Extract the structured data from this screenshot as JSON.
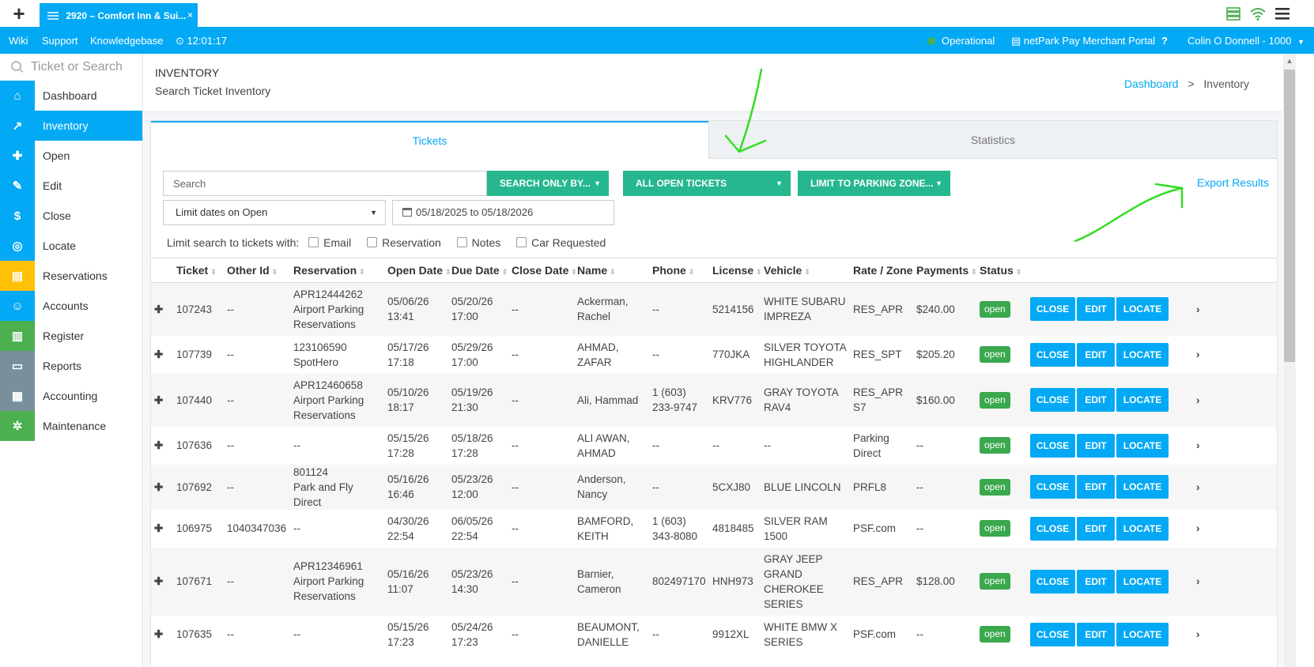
{
  "browser": {
    "new_tab": "+",
    "tab_title": "2920 – Comfort Inn & Sui...",
    "tab_close": "×"
  },
  "navbar": {
    "links": [
      "Wiki",
      "Support",
      "Knowledgebase"
    ],
    "clock": "12:01:17",
    "status": "Operational",
    "merchant_portal": "netPark Pay Merchant Portal",
    "help": "?",
    "user": "Colin O Donnell - 1000"
  },
  "sidebar": {
    "search_placeholder": "Ticket or Search",
    "items": [
      {
        "label": "Dashboard",
        "icon": "home-icon",
        "color": "#03a9f4"
      },
      {
        "label": "Inventory",
        "icon": "chart-icon",
        "color": "#03a9f4",
        "active": true
      },
      {
        "label": "Open",
        "icon": "plus-icon",
        "color": "#03a9f4"
      },
      {
        "label": "Edit",
        "icon": "pencil-icon",
        "color": "#03a9f4"
      },
      {
        "label": "Close",
        "icon": "dollar-icon",
        "color": "#03a9f4"
      },
      {
        "label": "Locate",
        "icon": "binoculars-icon",
        "color": "#03a9f4"
      },
      {
        "label": "Reservations",
        "icon": "document-icon",
        "color": "#ffc107"
      },
      {
        "label": "Accounts",
        "icon": "users-icon",
        "color": "#03a9f4"
      },
      {
        "label": "Register",
        "icon": "bank-icon",
        "color": "#4caf50"
      },
      {
        "label": "Reports",
        "icon": "folder-icon",
        "color": "#78909c"
      },
      {
        "label": "Accounting",
        "icon": "bar-chart-icon",
        "color": "#78909c"
      },
      {
        "label": "Maintenance",
        "icon": "gear-icon",
        "color": "#4caf50"
      }
    ]
  },
  "page": {
    "title": "INVENTORY",
    "subtitle": "Search Ticket Inventory",
    "breadcrumb_home": "Dashboard",
    "breadcrumb_sep": ">",
    "breadcrumb_current": "Inventory"
  },
  "tabs": {
    "tickets": "Tickets",
    "statistics": "Statistics"
  },
  "filters": {
    "search_placeholder": "Search",
    "search_only_by": "SEARCH ONLY BY...",
    "all_open_tickets": "ALL OPEN TICKETS",
    "limit_zone": "LIMIT TO PARKING ZONE...",
    "limit_dates": "Limit dates on Open",
    "date_range": "05/18/2025 to 05/18/2026",
    "export": "Export Results",
    "limit_label": "Limit search to tickets with:",
    "checkboxes": [
      "Email",
      "Reservation",
      "Notes",
      "Car Requested"
    ]
  },
  "table": {
    "columns": [
      "Ticket",
      "Other Id",
      "Reservation",
      "Open Date",
      "Due Date",
      "Close Date",
      "Name",
      "Phone",
      "License",
      "Vehicle",
      "Rate / Zone",
      "Payments",
      "Status"
    ],
    "actions": {
      "close": "CLOSE",
      "edit": "EDIT",
      "locate": "LOCATE"
    },
    "rows": [
      {
        "ticket": "107243",
        "other_id": "--",
        "reservation": [
          "APR12444262",
          "Airport Parking",
          "Reservations"
        ],
        "open": [
          "05/06/26",
          "13:41"
        ],
        "due": [
          "05/20/26",
          "17:00"
        ],
        "close": "--",
        "name": [
          "Ackerman,",
          "Rachel"
        ],
        "phone": [
          "--"
        ],
        "license": "5214156",
        "vehicle": [
          "WHITE SUBARU",
          "IMPREZA"
        ],
        "rate": [
          "RES_APR"
        ],
        "payments": "$240.00",
        "status": "open"
      },
      {
        "ticket": "107739",
        "other_id": "--",
        "reservation": [
          "123106590",
          "SpotHero"
        ],
        "open": [
          "05/17/26",
          "17:18"
        ],
        "due": [
          "05/29/26",
          "17:00"
        ],
        "close": "--",
        "name": [
          "AHMAD,",
          "ZAFAR"
        ],
        "phone": [
          "--"
        ],
        "license": "770JKA",
        "vehicle": [
          "SILVER TOYOTA",
          "HIGHLANDER"
        ],
        "rate": [
          "RES_SPT"
        ],
        "payments": "$205.20",
        "status": "open"
      },
      {
        "ticket": "107440",
        "other_id": "--",
        "reservation": [
          "APR12460658",
          "Airport Parking",
          "Reservations"
        ],
        "open": [
          "05/10/26",
          "18:17"
        ],
        "due": [
          "05/19/26",
          "21:30"
        ],
        "close": "--",
        "name": [
          "Ali, Hammad"
        ],
        "phone": [
          "1 (603)",
          "233-9747"
        ],
        "license": "KRV776",
        "vehicle": [
          "GRAY TOYOTA",
          "RAV4"
        ],
        "rate": [
          "RES_APR",
          "S7"
        ],
        "payments": "$160.00",
        "status": "open"
      },
      {
        "ticket": "107636",
        "other_id": "--",
        "reservation": [
          "--"
        ],
        "open": [
          "05/15/26",
          "17:28"
        ],
        "due": [
          "05/18/26",
          "17:28"
        ],
        "close": "--",
        "name": [
          "ALI AWAN,",
          "AHMAD"
        ],
        "phone": [
          "--"
        ],
        "license": "--",
        "vehicle": [
          "--"
        ],
        "rate": [
          "Parking",
          "Direct"
        ],
        "payments": "--",
        "status": "open"
      },
      {
        "ticket": "107692",
        "other_id": "--",
        "reservation": [
          "801124",
          "Park and Fly Direct"
        ],
        "open": [
          "05/16/26",
          "16:46"
        ],
        "due": [
          "05/23/26",
          "12:00"
        ],
        "close": "--",
        "name": [
          "Anderson,",
          "Nancy"
        ],
        "phone": [
          "--"
        ],
        "license": "5CXJ80",
        "vehicle": [
          "BLUE LINCOLN"
        ],
        "rate": [
          "PRFL8"
        ],
        "payments": "--",
        "status": "open"
      },
      {
        "ticket": "106975",
        "other_id": "1040347036",
        "reservation": [
          "--"
        ],
        "open": [
          "04/30/26",
          "22:54"
        ],
        "due": [
          "06/05/26",
          "22:54"
        ],
        "close": "--",
        "name": [
          "BAMFORD,",
          "KEITH"
        ],
        "phone": [
          "1 (603)",
          "343-8080"
        ],
        "license": "4818485",
        "vehicle": [
          "SILVER RAM",
          "1500"
        ],
        "rate": [
          "PSF.com"
        ],
        "payments": "--",
        "status": "open"
      },
      {
        "ticket": "107671",
        "other_id": "--",
        "reservation": [
          "APR12346961",
          "Airport Parking",
          "Reservations"
        ],
        "open": [
          "05/16/26",
          "11:07"
        ],
        "due": [
          "05/23/26",
          "14:30"
        ],
        "close": "--",
        "name": [
          "Barnier,",
          "Cameron"
        ],
        "phone": [
          "802497170"
        ],
        "license": "HNH973",
        "vehicle": [
          "GRAY JEEP",
          "GRAND",
          "CHEROKEE",
          "SERIES"
        ],
        "rate": [
          "RES_APR"
        ],
        "payments": "$128.00",
        "status": "open"
      },
      {
        "ticket": "107635",
        "other_id": "--",
        "reservation": [
          "--"
        ],
        "open": [
          "05/15/26",
          "17:23"
        ],
        "due": [
          "05/24/26",
          "17:23"
        ],
        "close": "--",
        "name": [
          "BEAUMONT,",
          "DANIELLE"
        ],
        "phone": [
          "--"
        ],
        "license": "9912XL",
        "vehicle": [
          "WHITE BMW X",
          "SERIES"
        ],
        "rate": [
          "PSF.com"
        ],
        "payments": "--",
        "status": "open"
      }
    ]
  },
  "colors": {
    "accent": "#03a9f4",
    "green_button": "#26b78f",
    "status_open": "#3aa84d"
  }
}
